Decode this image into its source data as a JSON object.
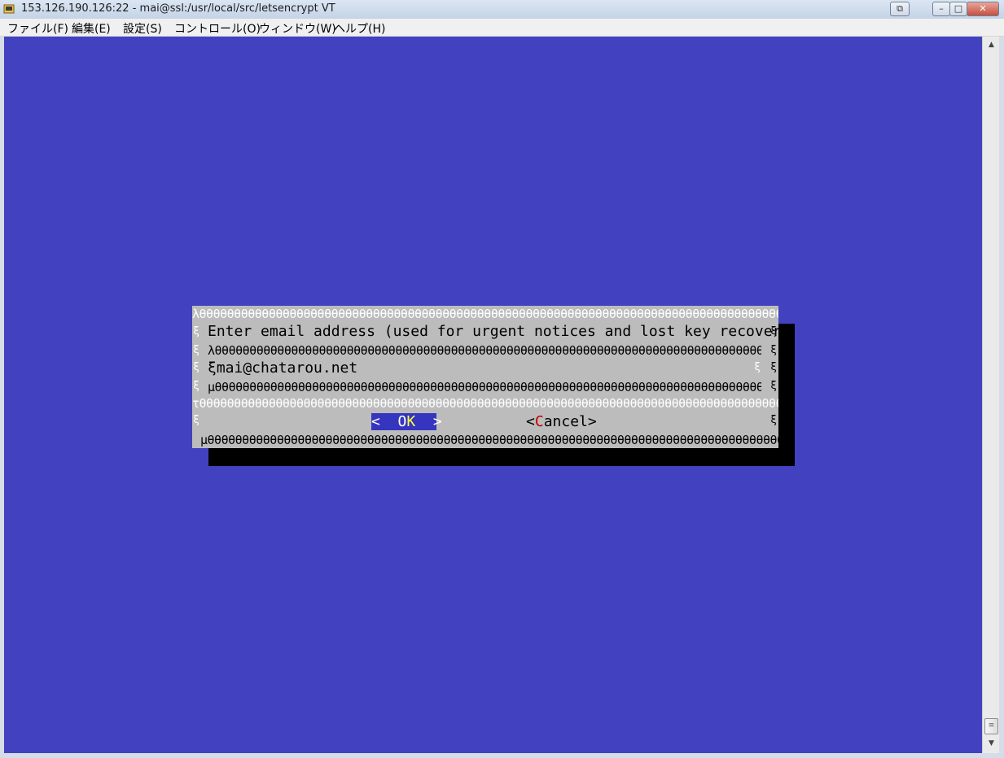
{
  "window": {
    "title": "153.126.190.126:22 - mai@ssl:/usr/local/src/letsencrypt VT",
    "btn_restore": "⧉",
    "btn_minimize": "–",
    "btn_maximize": "□",
    "btn_close": "✕"
  },
  "menu": {
    "file": "ファイル(F)",
    "edit": "編集(E)",
    "settings": "設定(S)",
    "control": "コントロール(O)",
    "window": "ウィンドウ(W)",
    "help": "ヘルプ(H)"
  },
  "dialog": {
    "top_border": "λθθθθθθθθθθθθθθθθθθθθθθθθθθθθθθθθθθθθθθθθθθθθθθθθθθθθθθθθθθθθθθθθθθθθθθθθθθθθθθθθθθθθθθθθθθθθθθθθθθθθθθθθθθθθθθθθθθθθθθθθθθθθθθθθθθθθθθθθθθθθθθθθθθθθθθθθθθθθθθθθθθκ",
    "prompt": "Enter email address (used for urgent notices and lost key recovery)",
    "input_top": "λθθθθθθθθθθθθθθθθθθθθθθθθθθθθθθθθθθθθθθθθθθθθθθθθθθθθθθθθθθθθθθθθθθθθθθθθθθθθθθθθθθθθθθθθθθθθθθθθθθθθθθθθθθθθθθθθθθθθθθθθθθθθθθθθθθθθθθθθθθθθθθθθθθθθθθθθθθθθθθθθθκ",
    "email_value": "ξmai@chatarou.net",
    "input_bottom": "μθθθθθθθθθθθθθθθθθθθθθθθθθθθθθθθθθθθθθθθθθθθθθθθθθθθθθθθθθθθθθθθθθθθθθθθθθθθθθθθθθθθθθθθθθθθθθθθθθθθθθθθθθθθθθθθθθθθθθθθθθθθθθθθθθθθθθθθθθθθθθθθθθθθθθθθθθθθθθθθφ",
    "separator": "τθθθθθθθθθθθθθθθθθθθθθθθθθθθθθθθθθθθθθθθθθθθθθθθθθθθθθθθθθθθθθθθθθθθθθθθθθθθθθθθθθθθθθθθθθθθθθθθθθθθθθθθθθθθθθθθθθθθθθθθθθθθθθθθθθθθθθθθθθθθθθθθθθθθθθθθθθθθθθθθθυ",
    "bottom_border": "μθθθθθθθθθθθθθθθθθθθθθθθθθθθθθθθθθθθθθθθθθθθθθθθθθθθθθθθθθθθθθθθθθθθθθθθθθθθθθθθθθθθθθθθθθθθθθθθθθθθθθθθθθθθθθθθθθθθθθθθθθθθθθθθθθθθθθθθθθθθθθθθθθθθθθθθθθθθθθθθφ",
    "side_char": "ξ",
    "ok_left": "<  ",
    "ok_k_hot": "K",
    "ok_o": "O",
    "ok_right": "  >",
    "cancel_left": "<",
    "cancel_hot": "C",
    "cancel_rest": "ancel>"
  },
  "scrollbar": {
    "up_arrow": "▲",
    "down_arrow": "▼",
    "thumb_grip": "≡"
  }
}
